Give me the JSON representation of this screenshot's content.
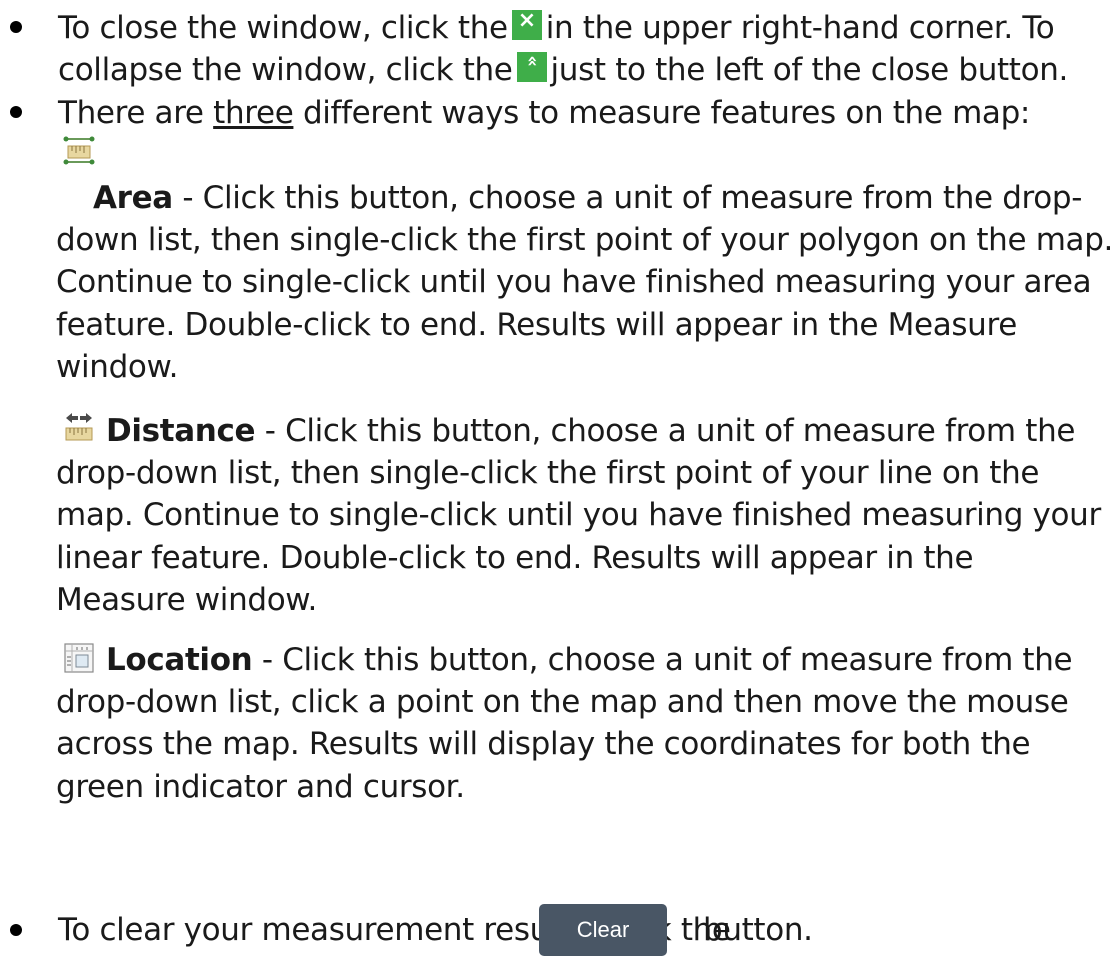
{
  "close_item": {
    "line1_pre": "To close the window, click the",
    "close_icon_glyph": "×",
    "line1_post": "in the upper right-hand corner. To",
    "line2_pre": "collapse the window, click the",
    "collapse_icon_glyph": "«",
    "line2_post": "just to the left of the close button."
  },
  "measure_item": {
    "pre": "There are",
    "underlined": "three",
    "post": "different ways to measure features on the map:"
  },
  "tools": {
    "area": {
      "icon": "area-measure-icon",
      "title": "Area",
      "lines": [
        "- Click this button, choose a unit of measure from the drop-",
        "down list, then single-click the first point of your polygon on the map.",
        "Continue to single-click until you have finished measuring your area",
        "feature. Double-click to end. Results will appear in the Measure",
        "window."
      ]
    },
    "distance": {
      "icon": "distance-measure-icon",
      "title": "Distance",
      "lines": [
        "- Click this button, choose a unit of measure from the",
        "drop-down list, then single-click the first point of your line on the",
        "map. Continue to single-click until you have finished measuring your",
        "linear feature. Double-click to end. Results will appear in the",
        "Measure window."
      ]
    },
    "location": {
      "icon": "location-measure-icon",
      "title": "Location",
      "lines": [
        "- Click this button, choose a unit of measure from the",
        "drop-down list, click a point on the map and then move the mouse",
        "across the map. Results will display the coordinates for both the",
        "green indicator and cursor."
      ]
    }
  },
  "clear_item": {
    "pre": "To clear your measurement results, click the",
    "button_label": "Clear",
    "post": "button."
  },
  "colors": {
    "green_button": "#3fae49",
    "clear_button": "#495665"
  }
}
